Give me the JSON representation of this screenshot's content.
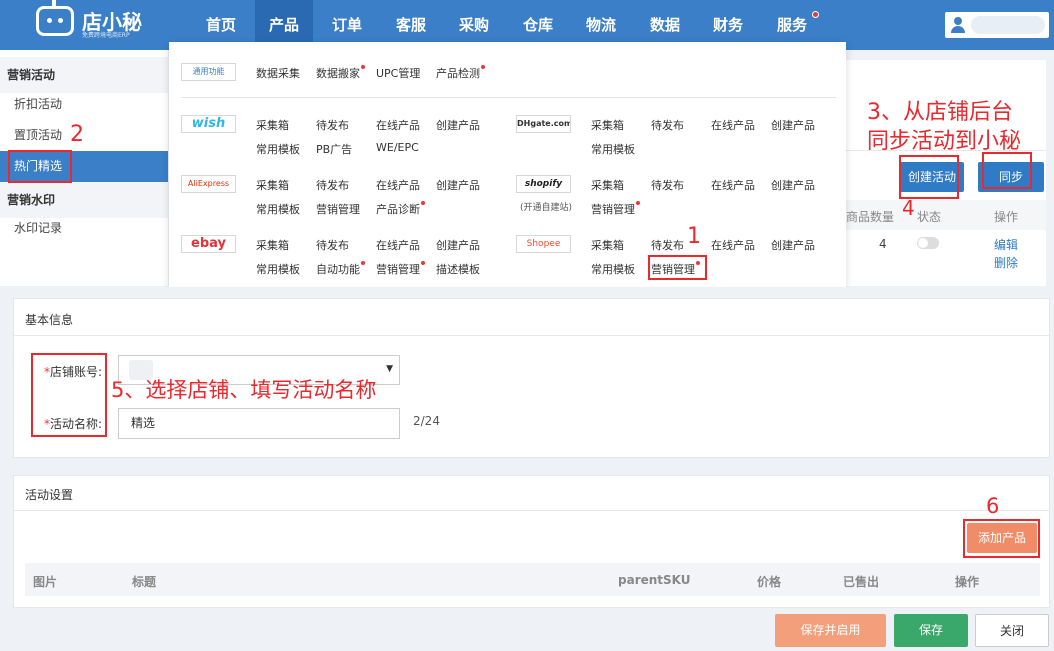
{
  "app": {
    "logo_title": "店小秘",
    "logo_subtitle": "免费跨境电商ERP"
  },
  "nav": {
    "items": [
      "首页",
      "产品",
      "订单",
      "客服",
      "采购",
      "仓库",
      "物流",
      "数据",
      "财务",
      "服务"
    ],
    "active": "产品"
  },
  "sidebar": {
    "section1_title": "营销活动",
    "section1_items": [
      "折扣活动",
      "置顶活动",
      "热门精选"
    ],
    "active_item": "热门精选",
    "section2_title": "营销水印",
    "section2_items": [
      "水印记录"
    ]
  },
  "background_page": {
    "create_button": "创建活动",
    "sync_button": "同步",
    "col_product_count": "商品数量",
    "col_status": "状态",
    "col_actions": "操作",
    "row_count": "4",
    "row_edit": "编辑",
    "row_delete": "删除"
  },
  "dropdown": {
    "general": {
      "logo": "通用功能",
      "items": [
        "数据采集",
        "数据搬家",
        "UPC管理",
        "产品检测"
      ]
    },
    "wish": {
      "logo": "wish",
      "row1": [
        "采集箱",
        "待发布",
        "在线产品",
        "创建产品"
      ],
      "row2": [
        "常用模板",
        "PB广告",
        "WE/EPC"
      ]
    },
    "dhgate": {
      "logo": "DHgate.com",
      "row1": [
        "采集箱",
        "待发布",
        "在线产品",
        "创建产品"
      ],
      "row2": [
        "常用模板"
      ]
    },
    "aliexpress": {
      "logo": "AliExpress",
      "row1": [
        "采集箱",
        "待发布",
        "在线产品",
        "创建产品"
      ],
      "row2": [
        "常用模板",
        "营销管理",
        "产品诊断"
      ]
    },
    "shopify": {
      "logo": "shopify",
      "note": "(开通自建站)",
      "row1": [
        "采集箱",
        "待发布",
        "在线产品",
        "创建产品"
      ],
      "row2": [
        "营销管理"
      ]
    },
    "ebay": {
      "logo": "ebay",
      "row1": [
        "采集箱",
        "待发布",
        "在线产品",
        "创建产品"
      ],
      "row2": [
        "常用模板",
        "自动功能",
        "营销管理",
        "描述模板"
      ]
    },
    "shopee": {
      "logo": "Shopee",
      "row1": [
        "采集箱",
        "待发布",
        "在线产品",
        "创建产品"
      ],
      "row2": [
        "常用模板",
        "营销管理"
      ]
    }
  },
  "form": {
    "basic_title": "基本信息",
    "shop_label": "店铺账号:",
    "shop_value": "",
    "name_label": "活动名称:",
    "name_value": "精选",
    "name_counter": "2/24",
    "settings_title": "活动设置",
    "add_product_button": "添加产品",
    "table_headers": [
      "图片",
      "标题",
      "parentSKU",
      "价格",
      "已售出",
      "操作"
    ]
  },
  "footer": {
    "save_enable": "保存并启用",
    "save": "保存",
    "close": "关闭"
  },
  "annotations": {
    "n1": "1",
    "n2": "2",
    "n3": "3、从店铺后台",
    "n3b": "同步活动到小秘",
    "n4": "4",
    "n5": "5、选择店铺、填写活动名称",
    "n6": "6"
  },
  "colors": {
    "primary": "#3b7fc8",
    "orange": "#f08d68",
    "green": "#3aa86b",
    "annotation": "#e8292e"
  }
}
